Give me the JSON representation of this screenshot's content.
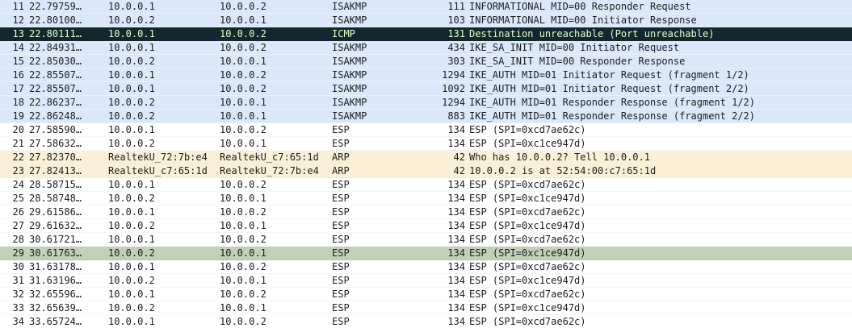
{
  "colors": {
    "isakmp_bg": "#dae8fa",
    "esp_bg": "#ffffff",
    "arp_bg": "#faf0d7",
    "icmp_bg": "#12272e",
    "icmp_fg": "#e4ffc7",
    "selected_bg": "#c1d1b8",
    "text": "#1e1e1e"
  },
  "packets": [
    {
      "no": "11",
      "time": "22.79759…",
      "source": "10.0.0.1",
      "destination": "10.0.0.2",
      "protocol": "ISAKMP",
      "length": "111",
      "info": "INFORMATIONAL MID=00 Responder Request",
      "style": "isakmp"
    },
    {
      "no": "12",
      "time": "22.80100…",
      "source": "10.0.0.2",
      "destination": "10.0.0.1",
      "protocol": "ISAKMP",
      "length": "103",
      "info": "INFORMATIONAL MID=00 Initiator Response",
      "style": "isakmp"
    },
    {
      "no": "13",
      "time": "22.80111…",
      "source": "10.0.0.1",
      "destination": "10.0.0.2",
      "protocol": "ICMP",
      "length": "131",
      "info": "Destination unreachable (Port unreachable)",
      "style": "icmp"
    },
    {
      "no": "14",
      "time": "22.84931…",
      "source": "10.0.0.1",
      "destination": "10.0.0.2",
      "protocol": "ISAKMP",
      "length": "434",
      "info": "IKE_SA_INIT MID=00 Initiator Request",
      "style": "isakmp"
    },
    {
      "no": "15",
      "time": "22.85030…",
      "source": "10.0.0.2",
      "destination": "10.0.0.1",
      "protocol": "ISAKMP",
      "length": "303",
      "info": "IKE_SA_INIT MID=00 Responder Response",
      "style": "isakmp"
    },
    {
      "no": "16",
      "time": "22.85507…",
      "source": "10.0.0.1",
      "destination": "10.0.0.2",
      "protocol": "ISAKMP",
      "length": "1294",
      "info": "IKE_AUTH MID=01 Initiator Request (fragment 1/2)",
      "style": "isakmp"
    },
    {
      "no": "17",
      "time": "22.85507…",
      "source": "10.0.0.1",
      "destination": "10.0.0.2",
      "protocol": "ISAKMP",
      "length": "1092",
      "info": "IKE_AUTH MID=01 Initiator Request (fragment 2/2)",
      "style": "isakmp"
    },
    {
      "no": "18",
      "time": "22.86237…",
      "source": "10.0.0.2",
      "destination": "10.0.0.1",
      "protocol": "ISAKMP",
      "length": "1294",
      "info": "IKE_AUTH MID=01 Responder Response (fragment 1/2)",
      "style": "isakmp"
    },
    {
      "no": "19",
      "time": "22.86248…",
      "source": "10.0.0.2",
      "destination": "10.0.0.1",
      "protocol": "ISAKMP",
      "length": "883",
      "info": "IKE_AUTH MID=01 Responder Response (fragment 2/2)",
      "style": "isakmp"
    },
    {
      "no": "20",
      "time": "27.58590…",
      "source": "10.0.0.1",
      "destination": "10.0.0.2",
      "protocol": "ESP",
      "length": "134",
      "info": "ESP (SPI=0xcd7ae62c)",
      "style": "esp"
    },
    {
      "no": "21",
      "time": "27.58632…",
      "source": "10.0.0.2",
      "destination": "10.0.0.1",
      "protocol": "ESP",
      "length": "134",
      "info": "ESP (SPI=0xc1ce947d)",
      "style": "esp"
    },
    {
      "no": "22",
      "time": "27.82370…",
      "source": "RealtekU_72:7b:e4",
      "destination": "RealtekU_c7:65:1d",
      "protocol": "ARP",
      "length": "42",
      "info": "Who has 10.0.0.2? Tell 10.0.0.1",
      "style": "arp"
    },
    {
      "no": "23",
      "time": "27.82413…",
      "source": "RealtekU_c7:65:1d",
      "destination": "RealtekU_72:7b:e4",
      "protocol": "ARP",
      "length": "42",
      "info": "10.0.0.2 is at 52:54:00:c7:65:1d",
      "style": "arp"
    },
    {
      "no": "24",
      "time": "28.58715…",
      "source": "10.0.0.1",
      "destination": "10.0.0.2",
      "protocol": "ESP",
      "length": "134",
      "info": "ESP (SPI=0xcd7ae62c)",
      "style": "esp"
    },
    {
      "no": "25",
      "time": "28.58748…",
      "source": "10.0.0.2",
      "destination": "10.0.0.1",
      "protocol": "ESP",
      "length": "134",
      "info": "ESP (SPI=0xc1ce947d)",
      "style": "esp"
    },
    {
      "no": "26",
      "time": "29.61586…",
      "source": "10.0.0.1",
      "destination": "10.0.0.2",
      "protocol": "ESP",
      "length": "134",
      "info": "ESP (SPI=0xcd7ae62c)",
      "style": "esp"
    },
    {
      "no": "27",
      "time": "29.61632…",
      "source": "10.0.0.2",
      "destination": "10.0.0.1",
      "protocol": "ESP",
      "length": "134",
      "info": "ESP (SPI=0xc1ce947d)",
      "style": "esp"
    },
    {
      "no": "28",
      "time": "30.61721…",
      "source": "10.0.0.1",
      "destination": "10.0.0.2",
      "protocol": "ESP",
      "length": "134",
      "info": "ESP (SPI=0xcd7ae62c)",
      "style": "esp"
    },
    {
      "no": "29",
      "time": "30.61763…",
      "source": "10.0.0.2",
      "destination": "10.0.0.1",
      "protocol": "ESP",
      "length": "134",
      "info": "ESP (SPI=0xc1ce947d)",
      "style": "marked"
    },
    {
      "no": "30",
      "time": "31.63178…",
      "source": "10.0.0.1",
      "destination": "10.0.0.2",
      "protocol": "ESP",
      "length": "134",
      "info": "ESP (SPI=0xcd7ae62c)",
      "style": "esp"
    },
    {
      "no": "31",
      "time": "31.63196…",
      "source": "10.0.0.2",
      "destination": "10.0.0.1",
      "protocol": "ESP",
      "length": "134",
      "info": "ESP (SPI=0xc1ce947d)",
      "style": "esp"
    },
    {
      "no": "32",
      "time": "32.65596…",
      "source": "10.0.0.1",
      "destination": "10.0.0.2",
      "protocol": "ESP",
      "length": "134",
      "info": "ESP (SPI=0xcd7ae62c)",
      "style": "esp"
    },
    {
      "no": "33",
      "time": "32.65639…",
      "source": "10.0.0.2",
      "destination": "10.0.0.1",
      "protocol": "ESP",
      "length": "134",
      "info": "ESP (SPI=0xc1ce947d)",
      "style": "esp"
    },
    {
      "no": "34",
      "time": "33.65724…",
      "source": "10.0.0.1",
      "destination": "10.0.0.2",
      "protocol": "ESP",
      "length": "134",
      "info": "ESP (SPI=0xcd7ae62c)",
      "style": "esp"
    }
  ]
}
